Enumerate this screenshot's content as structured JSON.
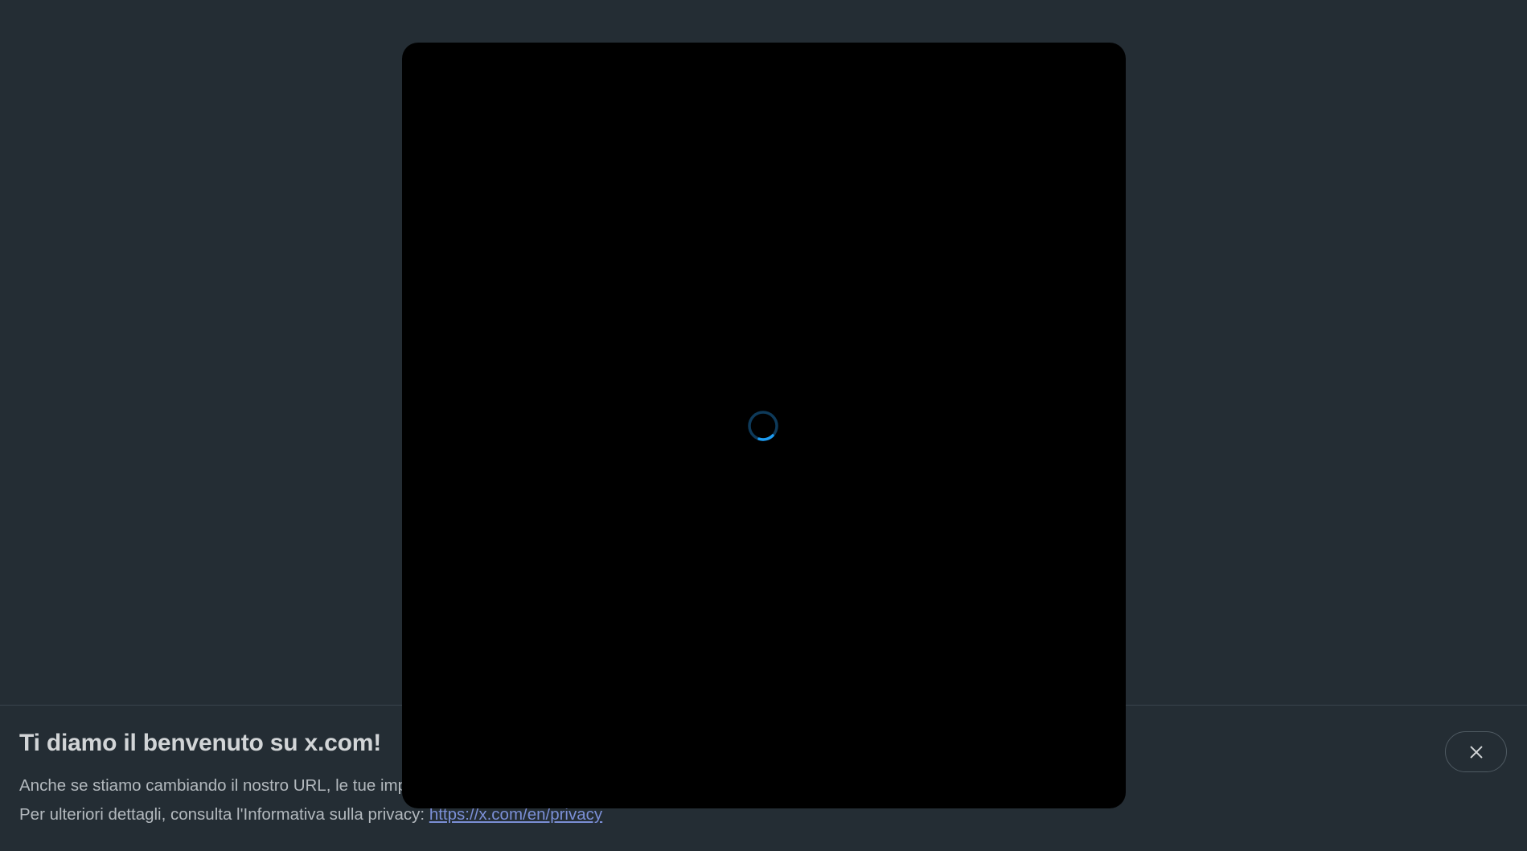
{
  "banner": {
    "title": "Ti diamo il benvenuto su x.com!",
    "line1": "Anche se stiamo cambiando il nostro URL, le tue impostazioni sulla privacy e sulla protezione dei dati restano invariate.",
    "line2_prefix": "Per ulteriori dettagli, consulta l'Informativa sulla privacy: ",
    "link_text": "https://x.com/en/privacy",
    "close_icon": "close-icon"
  },
  "modal": {
    "state": "loading",
    "spinner_icon": "loading-spinner-icon",
    "spinner_color": "#1d9bf0"
  },
  "colors": {
    "background": "#242d34",
    "modal": "#000000",
    "link": "#7b8fd6"
  }
}
